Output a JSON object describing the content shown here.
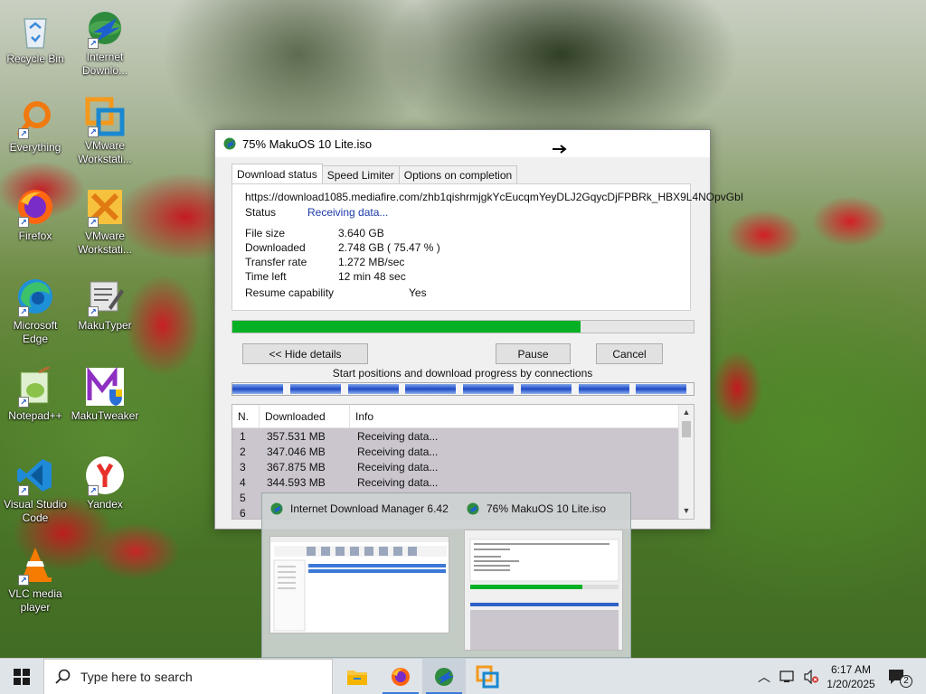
{
  "desktop": {
    "icons": [
      {
        "id": "recycle",
        "label": "Recycle Bin"
      },
      {
        "id": "idm",
        "label": "Internet Downlo..."
      },
      {
        "id": "everything",
        "label": "Everything"
      },
      {
        "id": "vmware1",
        "label": "VMware Workstati..."
      },
      {
        "id": "firefox",
        "label": "Firefox"
      },
      {
        "id": "vmware2",
        "label": "VMware Workstati..."
      },
      {
        "id": "edge",
        "label": "Microsoft Edge"
      },
      {
        "id": "makutyper",
        "label": "MakuTyper"
      },
      {
        "id": "notepadpp",
        "label": "Notepad++"
      },
      {
        "id": "makutweaker",
        "label": "MakuTweaker"
      },
      {
        "id": "vscode",
        "label": "Visual Studio Code"
      },
      {
        "id": "yandex",
        "label": "Yandex"
      },
      {
        "id": "vlc",
        "label": "VLC media player"
      }
    ]
  },
  "idm_window": {
    "title": "75% MakuOS 10 Lite.iso",
    "tabs": [
      "Download status",
      "Speed Limiter",
      "Options on completion"
    ],
    "url": "https://download1085.mediafire.com/zhb1qishrmjgkYcEucqmYeyDLJ2GqycDjFPBRk_HBX9L4NOpvGbI",
    "status": {
      "label": "Status",
      "value": "Receiving data..."
    },
    "file_size": {
      "label": "File size",
      "value": "3.640  GB"
    },
    "downloaded": {
      "label": "Downloaded",
      "value": "2.748  GB  ( 75.47 % )"
    },
    "transfer_rate": {
      "label": "Transfer rate",
      "value": "1.272  MB/sec"
    },
    "time_left": {
      "label": "Time left",
      "value": "12 min 48 sec"
    },
    "resume": {
      "label": "Resume capability",
      "value": "Yes"
    },
    "progress": 0.7547,
    "buttons": {
      "hide_details": "<< Hide details",
      "pause": "Pause",
      "cancel": "Cancel"
    },
    "connections_caption": "Start positions and download progress by connections",
    "connection_progress": [
      0.88,
      0.88,
      0.88,
      0.88,
      0.88,
      0.88,
      0.88,
      0.88
    ],
    "table": {
      "headers": [
        "N.",
        "Downloaded",
        "Info"
      ],
      "rows": [
        {
          "n": "1",
          "downloaded": "357.531  MB",
          "info": "Receiving data..."
        },
        {
          "n": "2",
          "downloaded": "347.046  MB",
          "info": "Receiving data..."
        },
        {
          "n": "3",
          "downloaded": "367.875  MB",
          "info": "Receiving data..."
        },
        {
          "n": "4",
          "downloaded": "344.593  MB",
          "info": "Receiving data..."
        },
        {
          "n": "5",
          "downloaded": "",
          "info": ""
        },
        {
          "n": "6",
          "downloaded": "",
          "info": ""
        }
      ]
    }
  },
  "taskbar_preview": {
    "items": [
      {
        "title": "Internet Download Manager 6.42"
      },
      {
        "title": "76% MakuOS 10 Lite.iso"
      }
    ]
  },
  "taskbar": {
    "search_placeholder": "Type here to search",
    "time": "6:17 AM",
    "date": "1/20/2025",
    "notification_count": "2"
  }
}
